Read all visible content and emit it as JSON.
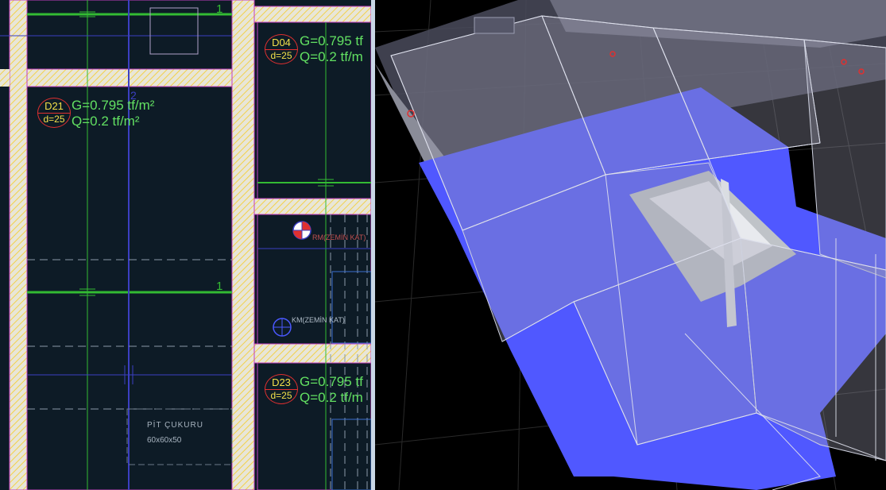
{
  "colors": {
    "cad_background": "#0d1b26",
    "hatch_yellow": "#f2d14a",
    "wall_border": "#c23fc0",
    "beam_line": "#33bb33",
    "axis_line": "#3b3fc2",
    "load_text": "#62e062",
    "slab_label_circle": "#e03030",
    "slab_blue": "#5058ff",
    "viewport_background": "#000000"
  },
  "plan": {
    "slabs": [
      {
        "id": "D04",
        "thickness": "d=25",
        "g": "G=0.795 tf",
        "q": "Q=0.2 tf/m"
      },
      {
        "id": "D21",
        "thickness": "d=25",
        "g": "G=0.795 tf/m²",
        "q": "Q=0.2 tf/m²"
      },
      {
        "id": "D23",
        "thickness": "d=25",
        "g": "G=0.795 tf",
        "q": "Q=0.2 tf/m"
      }
    ],
    "axis_label_1": "1",
    "axis_label_1b": "1",
    "axis_label_2": "2",
    "column_marks": [
      {
        "label": "RM(ZEMİN KAT)"
      },
      {
        "label": "KM(ZEMİN KAT)"
      }
    ],
    "pit": {
      "title": "PİT ÇUKURU",
      "size": "60x60x50"
    }
  },
  "model": {
    "icons": [
      "orbit-icon"
    ]
  }
}
